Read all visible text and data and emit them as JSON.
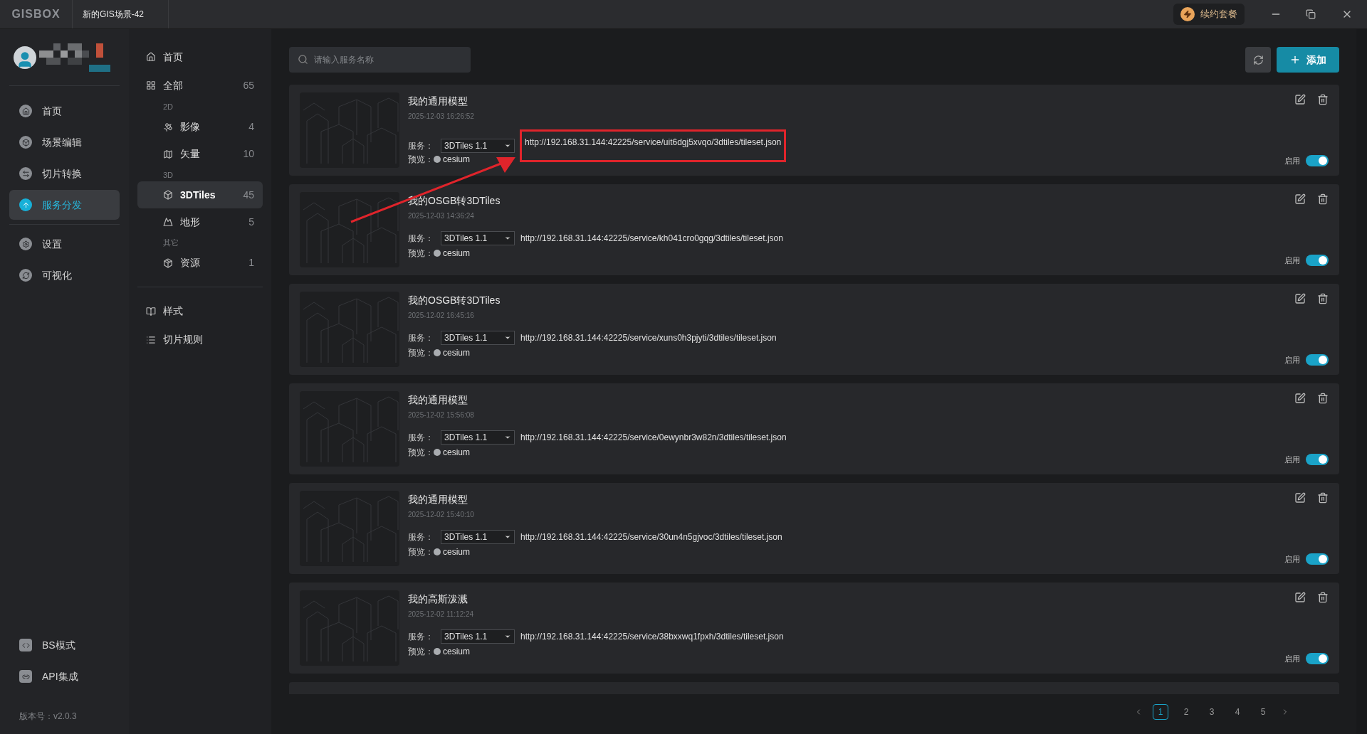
{
  "window": {
    "logo": "GISBOX",
    "tab": "新的GIS场景-42",
    "renew_button": "续约套餐"
  },
  "sidebar": {
    "items": [
      {
        "label": "首页",
        "kind": "home",
        "selected": false
      },
      {
        "label": "场景编辑",
        "kind": "cube",
        "selected": false
      },
      {
        "label": "切片转换",
        "kind": "swap",
        "selected": false
      },
      {
        "label": "服务分发",
        "kind": "upload",
        "selected": true
      },
      {
        "label": "设置",
        "kind": "gear",
        "selected": false
      },
      {
        "label": "可视化",
        "kind": "c",
        "selected": false
      }
    ],
    "bottom_items": [
      {
        "label": "BS模式",
        "kind": "code"
      },
      {
        "label": "API集成",
        "kind": "link"
      }
    ],
    "version": "版本号：v2.0.3"
  },
  "categories": {
    "top": [
      {
        "label": "首页",
        "kind": "home"
      },
      {
        "label": "全部",
        "kind": "grid",
        "count": "65"
      }
    ],
    "groups": [
      {
        "heading": "2D",
        "items": [
          {
            "label": "影像",
            "kind": "satellite",
            "count": "4",
            "selected": false
          },
          {
            "label": "矢量",
            "kind": "vector",
            "count": "10",
            "selected": false
          }
        ]
      },
      {
        "heading": "3D",
        "items": [
          {
            "label": "3DTiles",
            "kind": "cube",
            "count": "45",
            "selected": true
          },
          {
            "label": "地形",
            "kind": "mountain",
            "count": "5",
            "selected": false
          }
        ]
      },
      {
        "heading": "其它",
        "items": [
          {
            "label": "资源",
            "kind": "box",
            "count": "1",
            "selected": false
          }
        ]
      }
    ],
    "bottom": [
      {
        "label": "样式",
        "kind": "book"
      },
      {
        "label": "切片规则",
        "kind": "list"
      }
    ]
  },
  "toolbar": {
    "search": {
      "placeholder": "请输入服务名称"
    },
    "add_button": "添加"
  },
  "services": [
    {
      "title": "我的通用模型",
      "date": "2025-12-03 16:26:52",
      "service_label": "服务：",
      "format": "3DTiles 1.1",
      "url": "http://192.168.31.144:42225/service/uit6dgj5xvqo/3dtiles/tileset.json",
      "preview_label": "预览：",
      "preview": "cesium",
      "enable_label": "启用",
      "on": true,
      "highlighted": true
    },
    {
      "title": "我的OSGB转3DTiles",
      "date": "2025-12-03 14:36:24",
      "service_label": "服务：",
      "format": "3DTiles 1.1",
      "url": "http://192.168.31.144:42225/service/kh041cro0gqg/3dtiles/tileset.json",
      "preview_label": "预览：",
      "preview": "cesium",
      "enable_label": "启用",
      "on": true,
      "highlighted": false
    },
    {
      "title": "我的OSGB转3DTiles",
      "date": "2025-12-02 16:45:16",
      "service_label": "服务：",
      "format": "3DTiles 1.1",
      "url": "http://192.168.31.144:42225/service/xuns0h3pjyti/3dtiles/tileset.json",
      "preview_label": "预览：",
      "preview": "cesium",
      "enable_label": "启用",
      "on": true,
      "highlighted": false
    },
    {
      "title": "我的通用模型",
      "date": "2025-12-02 15:56:08",
      "service_label": "服务：",
      "format": "3DTiles 1.1",
      "url": "http://192.168.31.144:42225/service/0ewynbr3w82n/3dtiles/tileset.json",
      "preview_label": "预览：",
      "preview": "cesium",
      "enable_label": "启用",
      "on": true,
      "highlighted": false
    },
    {
      "title": "我的通用模型",
      "date": "2025-12-02 15:40:10",
      "service_label": "服务：",
      "format": "3DTiles 1.1",
      "url": "http://192.168.31.144:42225/service/30un4n5gjvoc/3dtiles/tileset.json",
      "preview_label": "预览：",
      "preview": "cesium",
      "enable_label": "启用",
      "on": true,
      "highlighted": false
    },
    {
      "title": "我的高斯泼溅",
      "date": "2025-12-02 11:12:24",
      "service_label": "服务：",
      "format": "3DTiles 1.1",
      "url": "http://192.168.31.144:42225/service/38bxxwq1fpxh/3dtiles/tileset.json",
      "preview_label": "预览：",
      "preview": "cesium",
      "enable_label": "启用",
      "on": true,
      "highlighted": false
    }
  ],
  "pagination": {
    "pages": [
      {
        "label": "1",
        "selected": true
      },
      {
        "label": "2",
        "selected": false
      },
      {
        "label": "3",
        "selected": false
      },
      {
        "label": "4",
        "selected": false
      },
      {
        "label": "5",
        "selected": false
      }
    ]
  }
}
